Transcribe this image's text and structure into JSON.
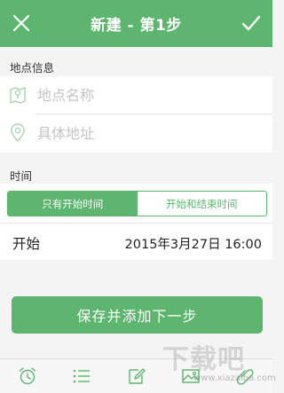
{
  "header": {
    "title": "新建 - 第1步",
    "close_icon": "close-icon",
    "confirm_icon": "check-icon"
  },
  "location": {
    "section_label": "地点信息",
    "name_placeholder": "地点名称",
    "address_placeholder": "具体地址",
    "name_icon": "map-icon",
    "address_icon": "location-pin-icon"
  },
  "time": {
    "section_label": "时间",
    "tabs": [
      {
        "label": "只有开始时间",
        "active": true
      },
      {
        "label": "开始和结束时间",
        "active": false
      }
    ],
    "start_label": "开始",
    "start_value": "2015年3月27日 16:00"
  },
  "save_button": {
    "label": "保存并添加下一步"
  },
  "tabbar": {
    "items": [
      {
        "icon": "alarm-clock-icon"
      },
      {
        "icon": "list-icon"
      },
      {
        "icon": "edit-note-icon"
      },
      {
        "icon": "image-icon"
      },
      {
        "icon": "paperclip-icon"
      }
    ]
  },
  "colors": {
    "accent": "#5db56f",
    "placeholder": "#c4c4c4",
    "background": "#f4f4f4"
  },
  "watermark": {
    "text": "下载吧",
    "url": "www.xiazaiba.com"
  }
}
